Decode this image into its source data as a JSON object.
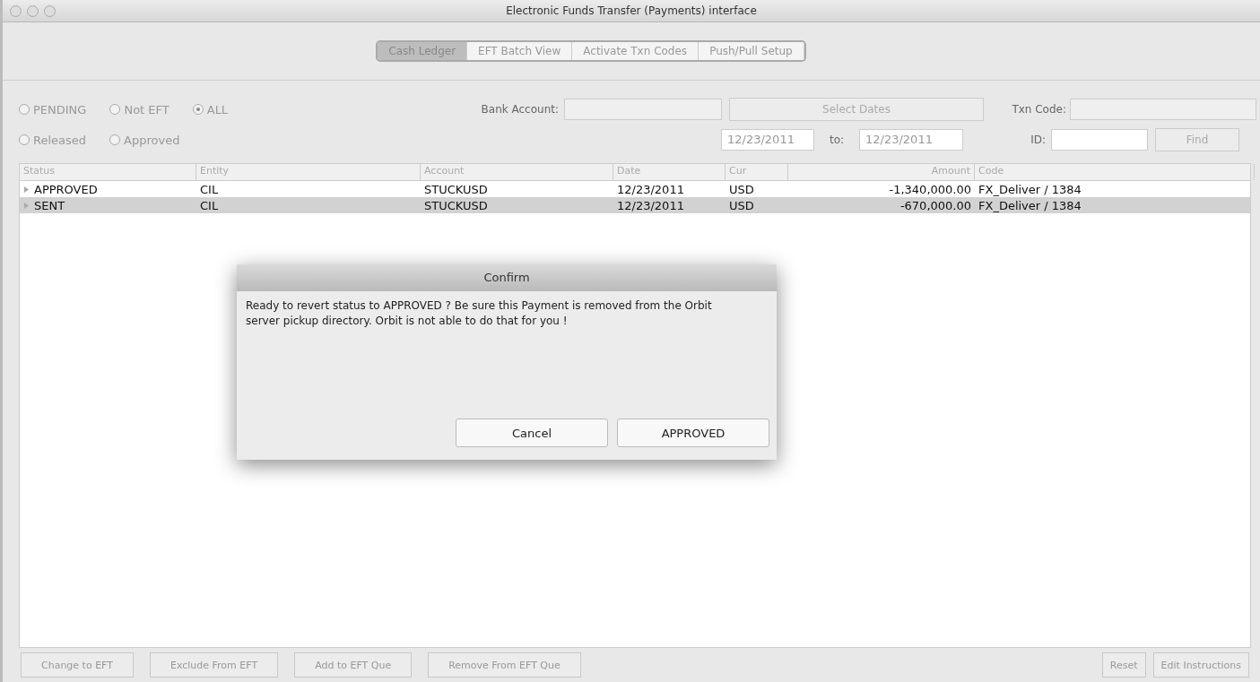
{
  "window": {
    "title": "Electronic Funds Transfer (Payments) interface"
  },
  "tabs": [
    {
      "label": "Cash Ledger",
      "selected": true
    },
    {
      "label": "EFT Batch View",
      "selected": false
    },
    {
      "label": "Activate Txn Codes",
      "selected": false
    },
    {
      "label": "Push/Pull Setup",
      "selected": false
    }
  ],
  "filters": {
    "radios": [
      {
        "label": "PENDING",
        "selected": false
      },
      {
        "label": "Not EFT",
        "selected": false
      },
      {
        "label": "ALL",
        "selected": true
      },
      {
        "label": "Released",
        "selected": false
      },
      {
        "label": "Approved",
        "selected": false
      }
    ],
    "bank_account_label": "Bank Account:",
    "select_dates_button": "Select Dates",
    "txn_code_label": "Txn Code:",
    "date_from": "12/23/2011",
    "to_label": "to:",
    "date_to": "12/23/2011",
    "id_label": "ID:",
    "find_button": "Find"
  },
  "table": {
    "columns": [
      "Status",
      "Entity",
      "Account",
      "Date",
      "Cur",
      "Amount",
      "Code"
    ],
    "rows": [
      {
        "cells": [
          "APPROVED",
          "CIL",
          "STUCKUSD",
          "12/23/2011",
          "USD",
          "-1,340,000.00",
          "FX_Deliver / 1384"
        ],
        "selected": false
      },
      {
        "cells": [
          "SENT",
          "CIL",
          "STUCKUSD",
          "12/23/2011",
          "USD",
          "-670,000.00",
          "FX_Deliver / 1384"
        ],
        "selected": true
      }
    ]
  },
  "dialog": {
    "title": "Confirm",
    "message": "Ready to revert status to APPROVED ?  Be sure this Payment is removed from the Orbit server pickup directory.  Orbit is not able to do that for you !",
    "buttons": [
      "Cancel",
      "APPROVED"
    ]
  },
  "bottom_buttons": {
    "left": [
      "Change to EFT",
      "Exclude From EFT",
      "Add to EFT Que",
      "Remove From EFT Que"
    ],
    "right": [
      "Reset",
      "Edit Instructions"
    ]
  }
}
